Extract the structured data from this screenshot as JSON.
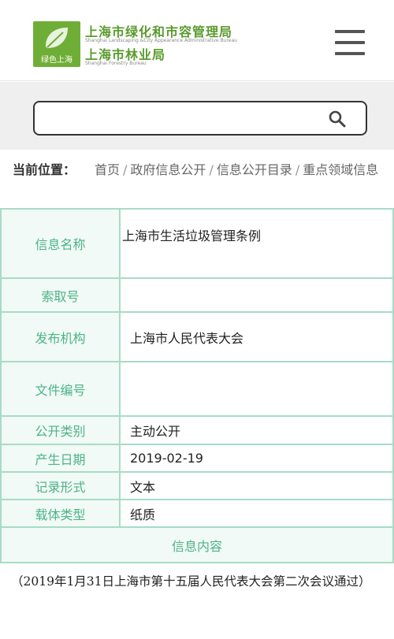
{
  "header": {
    "logo_caption": "绿色上海",
    "org_main": "上海市绿化和市容管理局",
    "org_main_en": "Shanghai Landscaping &City Appearance Administrative Bureau",
    "org_sub": "上海市林业局",
    "org_sub_en": "Shanghai Forestry Bureau"
  },
  "search": {
    "value": "",
    "placeholder": ""
  },
  "breadcrumb": {
    "label": "当前位置：",
    "items": [
      "首页",
      "政府信息公开",
      "信息公开目录",
      "重点领域信息"
    ],
    "separator": "/"
  },
  "info": {
    "rows": [
      {
        "label": "信息名称",
        "value": "上海市生活垃圾管理条例"
      },
      {
        "label": "索取号",
        "value": ""
      },
      {
        "label": "发布机构",
        "value": "上海市人民代表大会"
      },
      {
        "label": "文件编号",
        "value": ""
      },
      {
        "label": "公开类别",
        "value": "主动公开"
      },
      {
        "label": "产生日期",
        "value": "2019-02-19"
      },
      {
        "label": "记录形式",
        "value": "文本"
      },
      {
        "label": "载体类型",
        "value": "纸质"
      }
    ],
    "content_header": "信息内容"
  },
  "content": {
    "text": "（2019年1月31日上海市第十五届人民代表大会第二次会议通过）"
  },
  "colors": {
    "brand_green": "#5a9b2d",
    "table_border": "#a7dcc6",
    "label_text": "#4db387"
  }
}
